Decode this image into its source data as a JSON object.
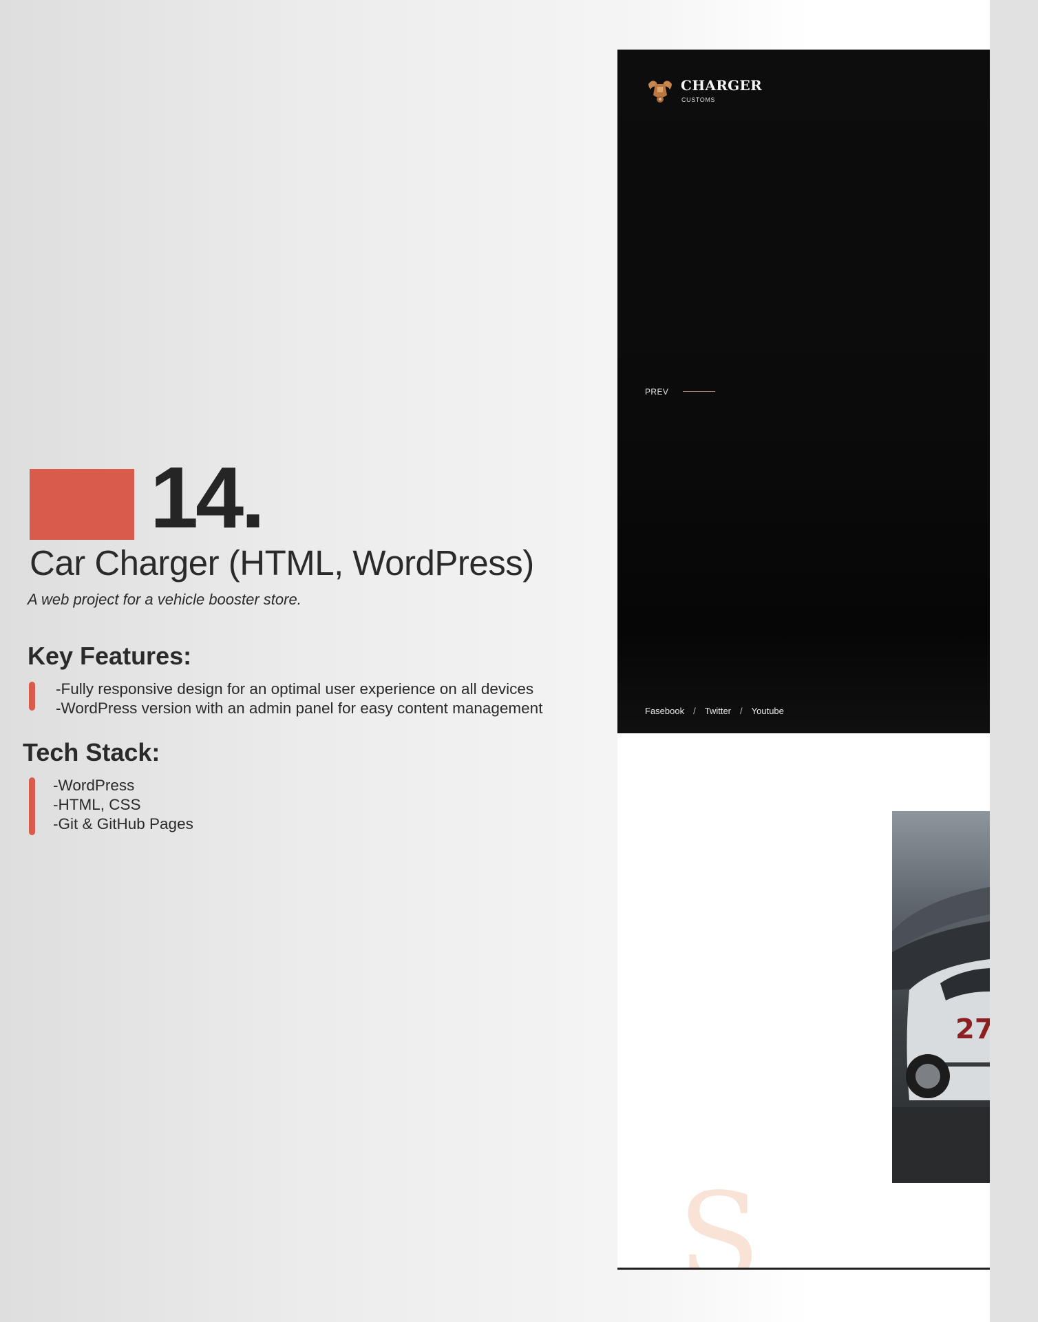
{
  "project": {
    "number": "14.",
    "title": "Car Charger (HTML, WordPress)",
    "subtitle": "A web project for a vehicle booster store."
  },
  "key_features": {
    "heading": "Key Features:",
    "items": [
      "-Fully responsive design for an optimal user experience on all devices",
      "-WordPress version with an admin panel for easy content management"
    ]
  },
  "tech_stack": {
    "heading": "Tech Stack:",
    "items": [
      "-WordPress",
      "-HTML, CSS",
      "-Git & GitHub Pages"
    ]
  },
  "preview": {
    "brand": "CHARGER",
    "tagline": "CUSTOMS",
    "prev_label": "PREV",
    "social": [
      "Fasebook",
      "Twitter",
      "Youtube"
    ],
    "social_separator": "/",
    "deco_letter": "S",
    "logo_icon": "engine-wings-logo-icon",
    "photo": "race-car-photo"
  },
  "colors": {
    "accent": "#d85b4b",
    "text": "#2a2a2a",
    "hero_bg": "#0b0b0b",
    "logo": "#c8864f",
    "deco_letter": "#f8e3d6"
  }
}
